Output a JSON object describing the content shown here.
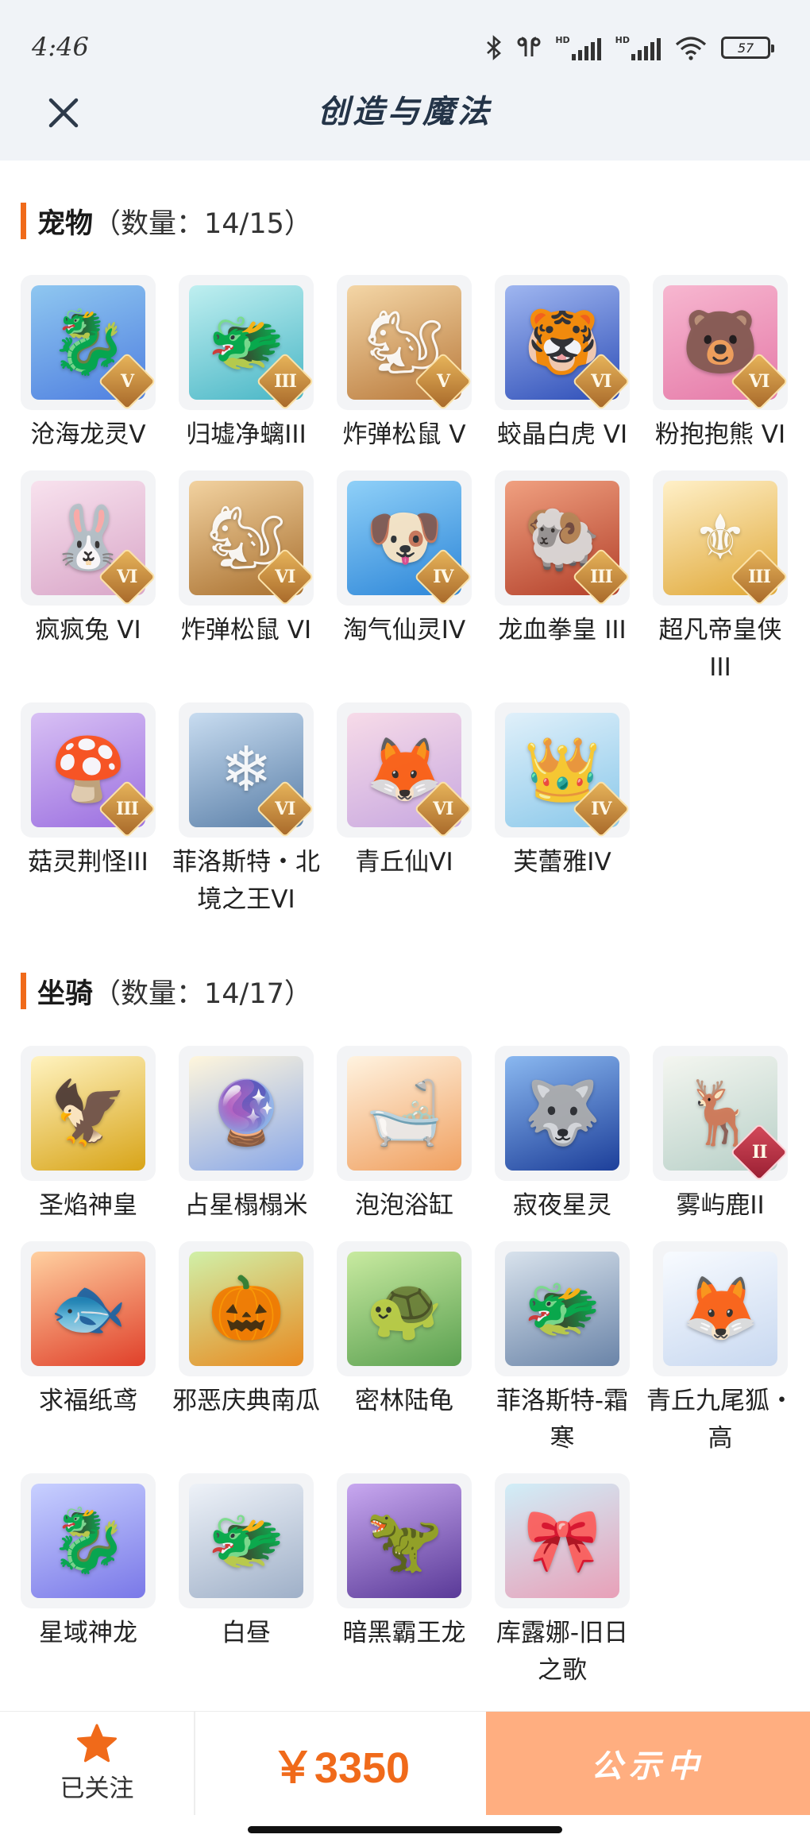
{
  "status": {
    "time": "4:46",
    "battery": "57",
    "hd1": "HD",
    "hd2": "HD"
  },
  "header": {
    "title": "创造与魔法"
  },
  "pets": {
    "title": "宠物",
    "count": "（数量：14/15）",
    "items": [
      {
        "name": "沧海龙灵V",
        "badge": "V",
        "colors": [
          "#8fc7f0",
          "#4f7fe0"
        ],
        "icon": "dragon-spirit-icon",
        "glyph": "🐉"
      },
      {
        "name": "归墟净螭III",
        "badge": "III",
        "colors": [
          "#bfeff0",
          "#49b6c6"
        ],
        "icon": "water-dragon-icon",
        "glyph": "🐲"
      },
      {
        "name": "炸弹松鼠 V",
        "badge": "V",
        "colors": [
          "#f4d6a6",
          "#b97a3c"
        ],
        "icon": "squirrel-icon",
        "glyph": "🐿"
      },
      {
        "name": "蛟晶白虎 VI",
        "badge": "VI",
        "colors": [
          "#9fb6f0",
          "#2f4fb8"
        ],
        "icon": "white-tiger-icon",
        "glyph": "🐯"
      },
      {
        "name": "粉抱抱熊 VI",
        "badge": "VI",
        "colors": [
          "#f7b7d0",
          "#e57aa8"
        ],
        "icon": "pink-bear-icon",
        "glyph": "🐻"
      },
      {
        "name": "疯疯兔 VI",
        "badge": "VI",
        "colors": [
          "#f8e2ee",
          "#d9a6c8"
        ],
        "icon": "rabbit-icon",
        "glyph": "🐰"
      },
      {
        "name": "炸弹松鼠 VI",
        "badge": "VI",
        "colors": [
          "#f2d2a0",
          "#a9702f"
        ],
        "icon": "squirrel-icon",
        "glyph": "🐿"
      },
      {
        "name": "淘气仙灵IV",
        "badge": "IV",
        "colors": [
          "#8fd0f8",
          "#2d86d8"
        ],
        "icon": "fairy-pup-icon",
        "glyph": "🐶"
      },
      {
        "name": "龙血拳皇 III",
        "badge": "III",
        "colors": [
          "#f0a080",
          "#b3402a"
        ],
        "icon": "ram-fighter-icon",
        "glyph": "🐏"
      },
      {
        "name": "超凡帝皇侠 III",
        "badge": "III",
        "colors": [
          "#fff0c8",
          "#e0a838"
        ],
        "icon": "golden-knight-icon",
        "glyph": "⚜"
      },
      {
        "name": "菇灵荆怪III",
        "badge": "III",
        "colors": [
          "#d8c0f4",
          "#9b6fe0"
        ],
        "icon": "mushroom-sprite-icon",
        "glyph": "🍄"
      },
      {
        "name": "菲洛斯特・北境之王VI",
        "badge": "VI",
        "colors": [
          "#c8dcf0",
          "#5a7fa8"
        ],
        "icon": "frost-king-icon",
        "glyph": "❄"
      },
      {
        "name": "青丘仙VI",
        "badge": "VI",
        "colors": [
          "#f7dbe8",
          "#c8a8e0"
        ],
        "icon": "fox-fairy-icon",
        "glyph": "🦊"
      },
      {
        "name": "芙蕾雅IV",
        "badge": "IV",
        "colors": [
          "#e0f0fa",
          "#8ac8ea"
        ],
        "icon": "goddess-icon",
        "glyph": "👑"
      }
    ]
  },
  "mounts": {
    "title": "坐骑",
    "count": "（数量：14/17）",
    "items": [
      {
        "name": "圣焰神皇",
        "badge": "",
        "colors": [
          "#fff3c0",
          "#d8a418"
        ],
        "icon": "golden-phoenix-icon",
        "glyph": "🦅"
      },
      {
        "name": "占星榻榻米",
        "badge": "",
        "colors": [
          "#fff6dc",
          "#8aa8e8"
        ],
        "icon": "astrology-mat-icon",
        "glyph": "🔮"
      },
      {
        "name": "泡泡浴缸",
        "badge": "",
        "colors": [
          "#fff3e0",
          "#f0a060"
        ],
        "icon": "bathtub-icon",
        "glyph": "🛁"
      },
      {
        "name": "寂夜星灵",
        "badge": "",
        "colors": [
          "#8ab8f0",
          "#1d3f9a"
        ],
        "icon": "night-wolf-icon",
        "glyph": "🐺"
      },
      {
        "name": "雾屿鹿II",
        "badge": "II",
        "badgeStyle": "red",
        "colors": [
          "#f4f6f0",
          "#b8d0c8"
        ],
        "icon": "deer-icon",
        "glyph": "🦌"
      },
      {
        "name": "求福纸鸢",
        "badge": "",
        "colors": [
          "#ffd0a0",
          "#e0402a"
        ],
        "icon": "goldfish-kite-icon",
        "glyph": "🐟"
      },
      {
        "name": "邪恶庆典南瓜",
        "badge": "",
        "colors": [
          "#d0f0a8",
          "#e88a20"
        ],
        "icon": "pumpkin-icon",
        "glyph": "🎃"
      },
      {
        "name": "密林陆龟",
        "badge": "",
        "colors": [
          "#c8eaa0",
          "#5aa050"
        ],
        "icon": "turtle-icon",
        "glyph": "🐢"
      },
      {
        "name": "菲洛斯特-霜寒",
        "badge": "",
        "colors": [
          "#d8e2ec",
          "#6a84a8"
        ],
        "icon": "frost-dragon-icon",
        "glyph": "🐲"
      },
      {
        "name": "青丘九尾狐・高",
        "badge": "",
        "colors": [
          "#f8fbff",
          "#c8d8f0"
        ],
        "icon": "nine-tail-fox-icon",
        "glyph": "🦊"
      },
      {
        "name": "星域神龙",
        "badge": "",
        "colors": [
          "#c8d0ff",
          "#7a78e8"
        ],
        "icon": "star-dragon-icon",
        "glyph": "🐉"
      },
      {
        "name": "白昼",
        "badge": "",
        "colors": [
          "#eef2f8",
          "#9fb0c8"
        ],
        "icon": "white-dragon-icon",
        "glyph": "🐲"
      },
      {
        "name": "暗黑霸王龙",
        "badge": "",
        "colors": [
          "#c8a8f0",
          "#5a3a98"
        ],
        "icon": "dark-trex-icon",
        "glyph": "🦖"
      },
      {
        "name": "库露娜-旧日之歌",
        "badge": "",
        "colors": [
          "#d0eef8",
          "#e8a0b8"
        ],
        "icon": "kuluna-icon",
        "glyph": "🎀"
      }
    ]
  },
  "bottom": {
    "follow_label": "已关注",
    "price": "￥3350",
    "status_label": "公示中"
  },
  "theme": {
    "accent": "#f06a1a",
    "status_button": "#ffae80",
    "header_bg": "#f0f3f7"
  }
}
